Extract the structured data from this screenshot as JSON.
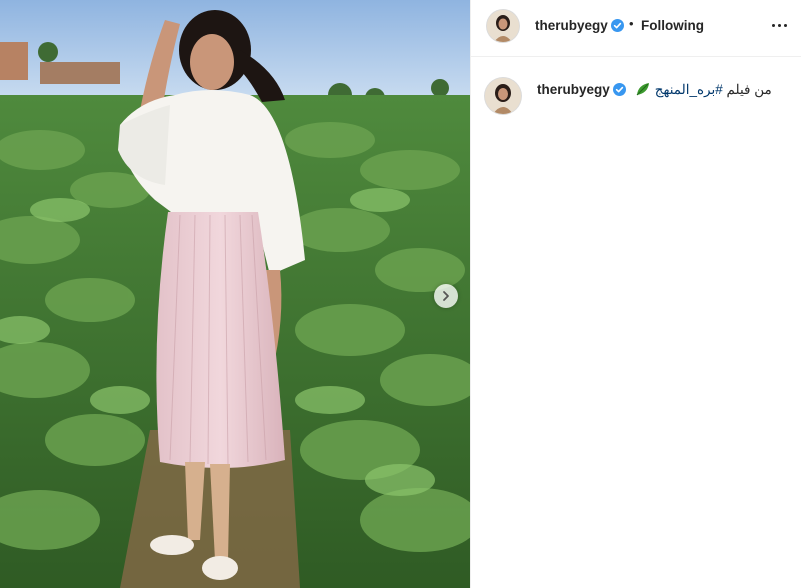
{
  "post": {
    "username": "therubyegy",
    "follow_status": "Following",
    "separator": "•",
    "caption_prefix": "من فيلم",
    "caption_hashtag": "#بره_المنهج",
    "caption_emoji_icon": "leafy-green-emoji-icon",
    "verified_icon": "verified-badge-icon",
    "verified_color": "#3897f0",
    "more_icon": "more-options-icon",
    "carousel_next_icon": "chevron-right-icon"
  },
  "colors": {
    "text": "#262626",
    "hashtag": "#00376b",
    "border": "#efefef"
  }
}
